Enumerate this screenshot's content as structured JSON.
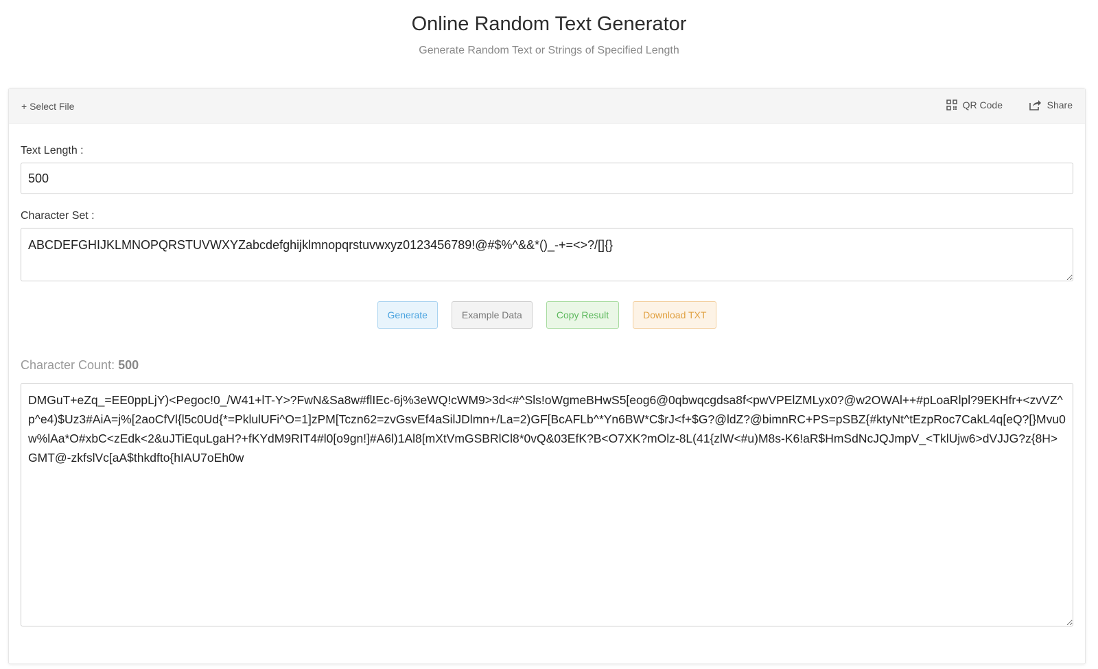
{
  "header": {
    "title": "Online Random Text Generator",
    "subtitle": "Generate Random Text or Strings of Specified Length"
  },
  "toolbar": {
    "select_file": "+ Select File",
    "qr_code": "QR Code",
    "share": "Share"
  },
  "form": {
    "length_label": "Text Length :",
    "length_value": "500",
    "charset_label": "Character Set :",
    "charset_value": "ABCDEFGHIJKLMNOPQRSTUVWXYZabcdefghijklmnopqrstuvwxyz0123456789!@#$%^&&*()_-+=<>?/[]{}"
  },
  "buttons": {
    "generate": "Generate",
    "example": "Example Data",
    "copy": "Copy Result",
    "download": "Download TXT"
  },
  "result": {
    "count_label": "Character Count:",
    "count_value": "500",
    "text": "DMGuT+eZq_=EE0ppLjY)<Pegoc!0_/W41+lT-Y>?FwN&Sa8w#flIEc-6j%3eWQ!cWM9>3d<#^Sls!oWgmeBHwS5[eog6@0qbwqcgdsa8f<pwVPElZMLyx0?@w2OWAl++#pLoaRlpl?9EKHfr+<zvVZ^p^e4)$Uz3#AiA=j%[2aoCfVl{l5c0Ud{*=PklulUFi^O=1]zPM[Tczn62=zvGsvEf4aSilJDlmn+/La=2)GF[BcAFLb^*Yn6BW*C$rJ<f+$G?@ldZ?@bimnRC+PS=pSBZ{#ktyNt^tEzpRoc7CakL4q[eQ?[}Mvu0w%lAa*O#xbC<zEdk<2&uJTiEquLgaH?+fKYdM9RIT4#l0[o9gn!]#A6l)1Al8[mXtVmGSBRlCl8*0vQ&03EfK?B<O7XK?mOlz-8L(41{zlW<#u)M8s-K6!aR$HmSdNcJQJmpV_<TklUjw6>dVJJG?z{8H>GMT@-zkfslVc[aA$thkdfto{hIAU7oEh0w"
  },
  "colors": {
    "generate": "#4aa3df",
    "example": "#777777",
    "copy": "#5cb85c",
    "download": "#e0a040"
  }
}
